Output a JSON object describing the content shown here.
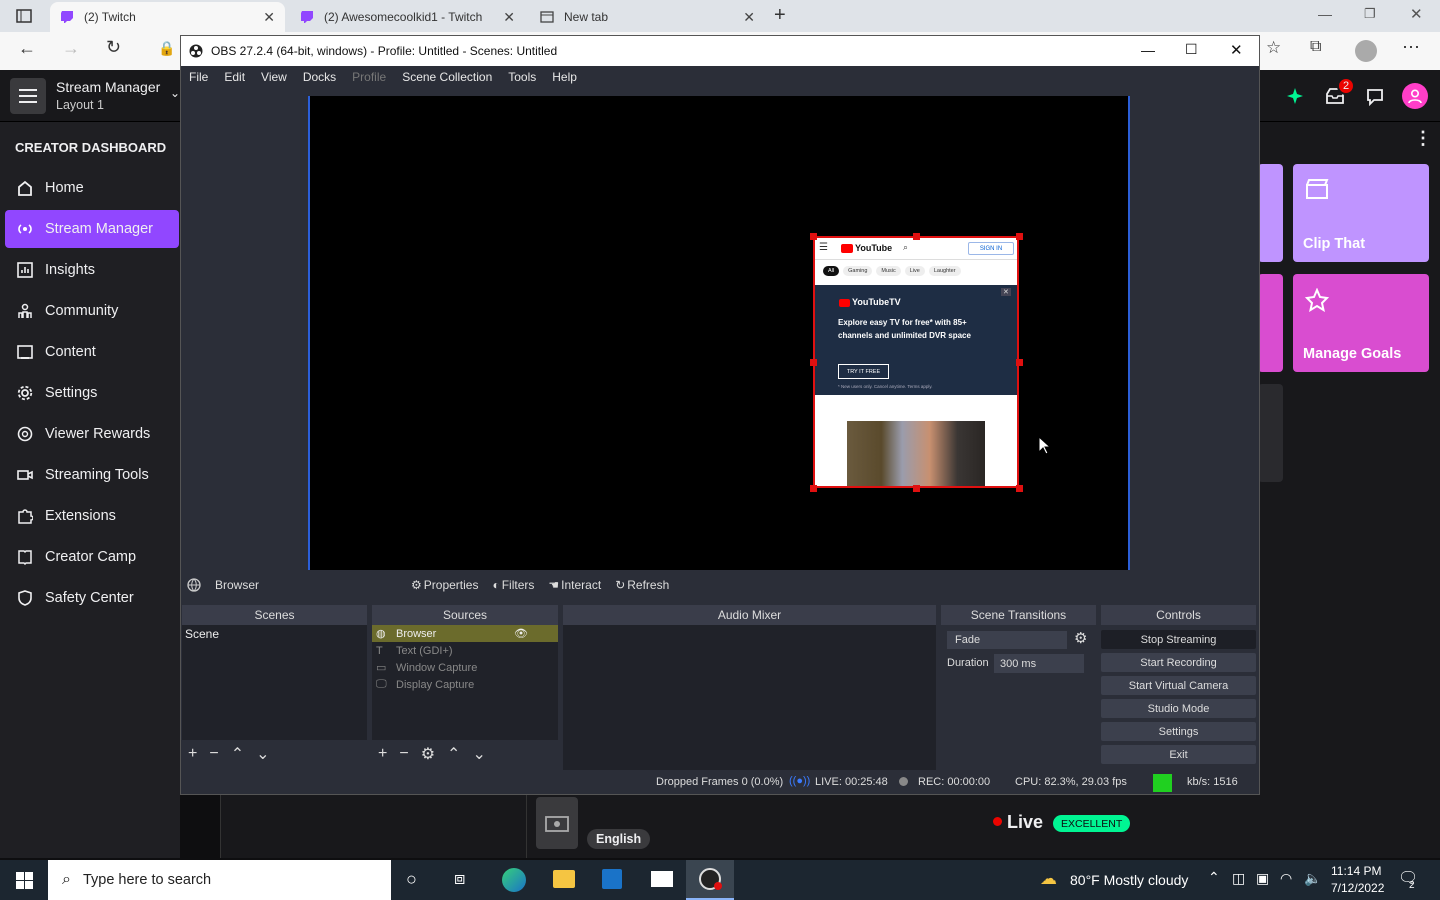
{
  "browser": {
    "tabs": [
      {
        "label": "(2) Twitch"
      },
      {
        "label": "(2) Awesomecoolkid1 - Twitch"
      },
      {
        "label": "New tab"
      }
    ]
  },
  "twitch": {
    "header": {
      "title": "Stream Manager",
      "subtitle": "Layout 1",
      "notif_count": "2"
    },
    "sidebar": {
      "heading": "CREATOR DASHBOARD",
      "items": [
        {
          "label": "Home"
        },
        {
          "label": "Stream Manager"
        },
        {
          "label": "Insights"
        },
        {
          "label": "Community"
        },
        {
          "label": "Content"
        },
        {
          "label": "Settings"
        },
        {
          "label": "Viewer Rewards"
        },
        {
          "label": "Streaming Tools"
        },
        {
          "label": "Extensions"
        },
        {
          "label": "Creator Camp"
        },
        {
          "label": "Safety Center"
        }
      ]
    },
    "quick_actions": [
      {
        "label": "Clip That"
      },
      {
        "label": "Manage Goals"
      }
    ],
    "footer": {
      "language": "English",
      "live_label": "Live",
      "health": "EXCELLENT"
    },
    "colors": {
      "accent": "#9147ff",
      "quick_action": "#bf94ff",
      "manage_goals": "#ff3ec8"
    }
  },
  "obs": {
    "title": "OBS 27.2.4 (64-bit, windows) - Profile: Untitled - Scenes: Untitled",
    "menu": [
      "File",
      "Edit",
      "View",
      "Docks",
      "Profile",
      "Scene Collection",
      "Tools",
      "Help"
    ],
    "source_bar": {
      "name": "Browser",
      "properties": "Properties",
      "filters": "Filters",
      "interact": "Interact",
      "refresh": "Refresh"
    },
    "docks": {
      "scenes": "Scenes",
      "sources": "Sources",
      "audio": "Audio Mixer",
      "transitions": "Scene Transitions",
      "controls": "Controls"
    },
    "scenes": [
      "Scene"
    ],
    "sources": [
      {
        "label": "Browser"
      },
      {
        "label": "Text (GDI+)"
      },
      {
        "label": "Window Capture"
      },
      {
        "label": "Display Capture"
      }
    ],
    "transition": {
      "type": "Fade",
      "duration_label": "Duration",
      "duration": "300 ms"
    },
    "controls": [
      "Stop Streaming",
      "Start Recording",
      "Start Virtual Camera",
      "Studio Mode",
      "Settings",
      "Exit"
    ],
    "status": {
      "dropped": "Dropped Frames 0 (0.0%)",
      "live": "LIVE: 00:25:48",
      "rec": "REC: 00:00:00",
      "cpu": "CPU: 82.3%, 29.03 fps",
      "kbs": "kb/s: 1516"
    },
    "preview": {
      "yt_logo": "YouTube",
      "signin": "SIGN IN",
      "chips": [
        "All",
        "Gaming",
        "Music",
        "Live",
        "Laughter"
      ],
      "ad_brand": "YouTubeTV",
      "ad_text": "Explore easy TV for free* with 85+ channels and unlimited DVR space",
      "ad_button": "TRY IT FREE",
      "ad_fine": "* New users only. Cancel anytime. Terms apply."
    }
  },
  "taskbar": {
    "search_placeholder": "Type here to search",
    "weather": "80°F  Mostly cloudy",
    "time": "11:14 PM",
    "date": "7/12/2022",
    "notif": "2"
  }
}
